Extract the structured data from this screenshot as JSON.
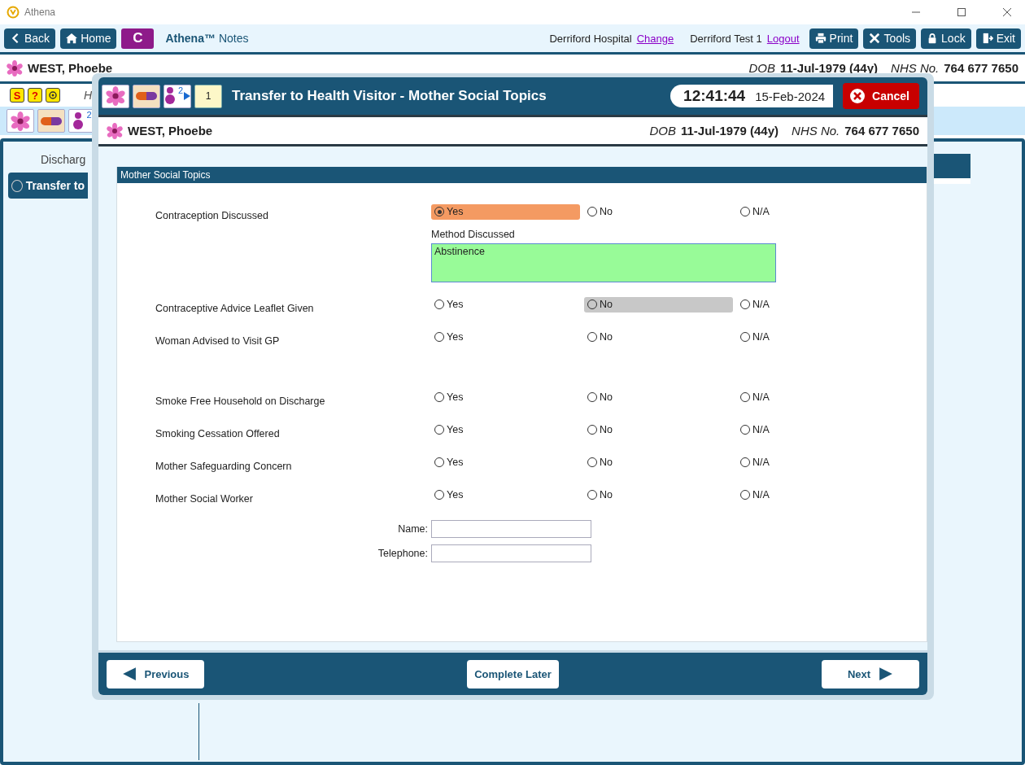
{
  "app_title": "Athena",
  "toolbar": {
    "nav": [
      {
        "label": "Back",
        "kind": "back"
      },
      {
        "label": "Home",
        "kind": "home"
      }
    ],
    "badge": "C",
    "app_name": "Athena™",
    "app_section": "Notes",
    "hospital": "Derriford Hospital",
    "change_link": "Change",
    "user": "Derriford Test 1",
    "logout_link": "Logout",
    "actions": [
      {
        "label": "Print",
        "kind": "print"
      },
      {
        "label": "Tools",
        "kind": "tools"
      },
      {
        "label": "Lock",
        "kind": "lock"
      },
      {
        "label": "Exit",
        "kind": "exit"
      }
    ]
  },
  "patient": {
    "name": "WEST, Phoebe",
    "dob_label": "DOB",
    "dob": "11-Jul-1979 (44y)",
    "nhs_label": "NHS No.",
    "nhs": "764 677 7650"
  },
  "background": {
    "small_icons": [
      {
        "kind": "hand",
        "glyph": "S"
      },
      {
        "kind": "help",
        "glyph": "?"
      },
      {
        "kind": "gear"
      }
    ],
    "partial_text": "H",
    "baby_count": "2",
    "section_title": "Discharg",
    "nav_item": "Transfer to"
  },
  "dialog": {
    "title": "Transfer to Health Visitor - Mother Social Topics",
    "baby_count": "2",
    "note_count": "1",
    "time": "12:41:44",
    "date": "15-Feb-2024",
    "cancel": "Cancel",
    "patient": {
      "name": "WEST, Phoebe",
      "dob_label": "DOB",
      "dob": "11-Jul-1979 (44y)",
      "nhs_label": "NHS No.",
      "nhs": "764 677 7650"
    },
    "section": "Mother Social Topics",
    "groups": [
      [
        {
          "label": "Contraception Discussed",
          "options": [
            {
              "label": "Yes",
              "selected": true,
              "focused": false
            },
            {
              "label": "No",
              "selected": false,
              "focused": false
            },
            {
              "label": "N/A",
              "selected": false,
              "focused": false
            }
          ],
          "detail": {
            "label": "Method Discussed",
            "value": "Abstinence"
          }
        },
        {
          "label": "Contraceptive Advice Leaflet Given",
          "options": [
            {
              "label": "Yes",
              "selected": false,
              "focused": false
            },
            {
              "label": "No",
              "selected": false,
              "focused": true
            },
            {
              "label": "N/A",
              "selected": false,
              "focused": false
            }
          ]
        },
        {
          "label": "Woman Advised to Visit GP",
          "options": [
            {
              "label": "Yes",
              "selected": false,
              "focused": false
            },
            {
              "label": "No",
              "selected": false,
              "focused": false
            },
            {
              "label": "N/A",
              "selected": false,
              "focused": false
            }
          ]
        }
      ],
      [
        {
          "label": "Smoke Free Household on Discharge",
          "options": [
            {
              "label": "Yes",
              "selected": false,
              "focused": false
            },
            {
              "label": "No",
              "selected": false,
              "focused": false
            },
            {
              "label": "N/A",
              "selected": false,
              "focused": false
            }
          ]
        },
        {
          "label": "Smoking Cessation Offered",
          "options": [
            {
              "label": "Yes",
              "selected": false,
              "focused": false
            },
            {
              "label": "No",
              "selected": false,
              "focused": false
            },
            {
              "label": "N/A",
              "selected": false,
              "focused": false
            }
          ]
        },
        {
          "label": "Mother Safeguarding Concern",
          "options": [
            {
              "label": "Yes",
              "selected": false,
              "focused": false
            },
            {
              "label": "No",
              "selected": false,
              "focused": false
            },
            {
              "label": "N/A",
              "selected": false,
              "focused": false
            }
          ]
        },
        {
          "label": "Mother Social Worker",
          "options": [
            {
              "label": "Yes",
              "selected": false,
              "focused": false
            },
            {
              "label": "No",
              "selected": false,
              "focused": false
            },
            {
              "label": "N/A",
              "selected": false,
              "focused": false
            }
          ]
        }
      ]
    ],
    "fields": [
      {
        "label": "Name:"
      },
      {
        "label": "Telephone:"
      }
    ],
    "footer": {
      "previous": "Previous",
      "later": "Complete Later",
      "next": "Next"
    }
  }
}
